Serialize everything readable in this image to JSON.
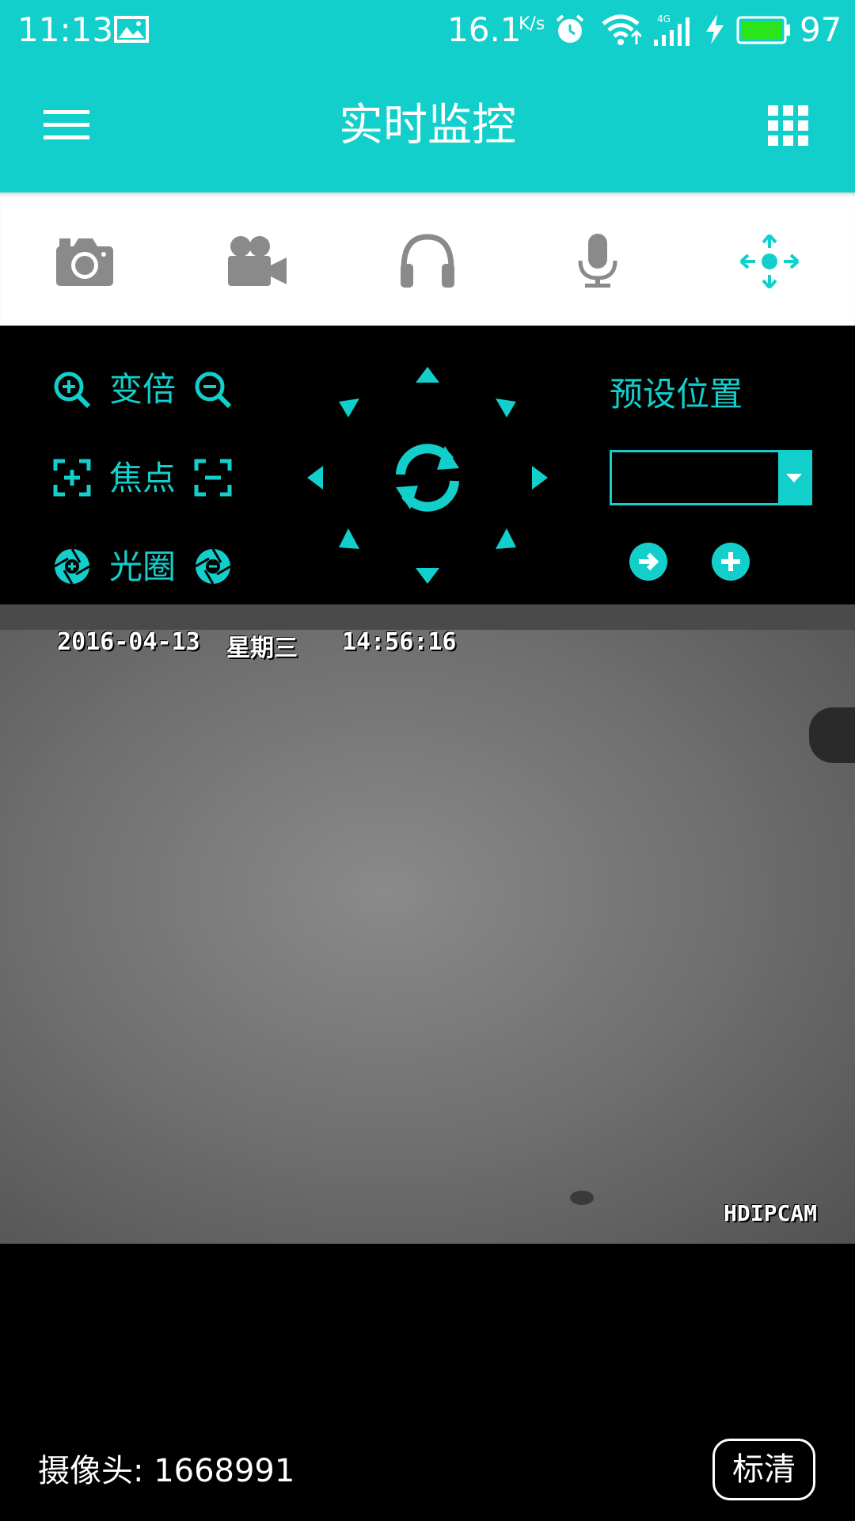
{
  "status_bar": {
    "time": "11:13",
    "speed": "16.1",
    "speed_unit": "K/s",
    "battery": "97",
    "network": "4G"
  },
  "app_bar": {
    "title": "实时监控",
    "menu_icon": "menu-icon",
    "grid_icon": "grid-icon"
  },
  "toolbar": {
    "tools": [
      {
        "icon": "camera-icon"
      },
      {
        "icon": "video-camera-icon"
      },
      {
        "icon": "headphones-icon"
      },
      {
        "icon": "microphone-icon"
      },
      {
        "icon": "ptz-move-icon",
        "active": true
      }
    ]
  },
  "controls": {
    "zoom_label": "变倍",
    "focus_label": "焦点",
    "iris_label": "光圈",
    "preset_label": "预设位置",
    "preset_value": ""
  },
  "video": {
    "date": "2016-04-13",
    "weekday": "星期三",
    "time": "14:56:16",
    "watermark": "HDIPCAM"
  },
  "bottom": {
    "camera_label": "摄像头: 1668991",
    "quality_label": "标清"
  },
  "colors": {
    "accent": "#13CFCB",
    "icon_gray": "#8a8a8a",
    "background": "#000000"
  }
}
